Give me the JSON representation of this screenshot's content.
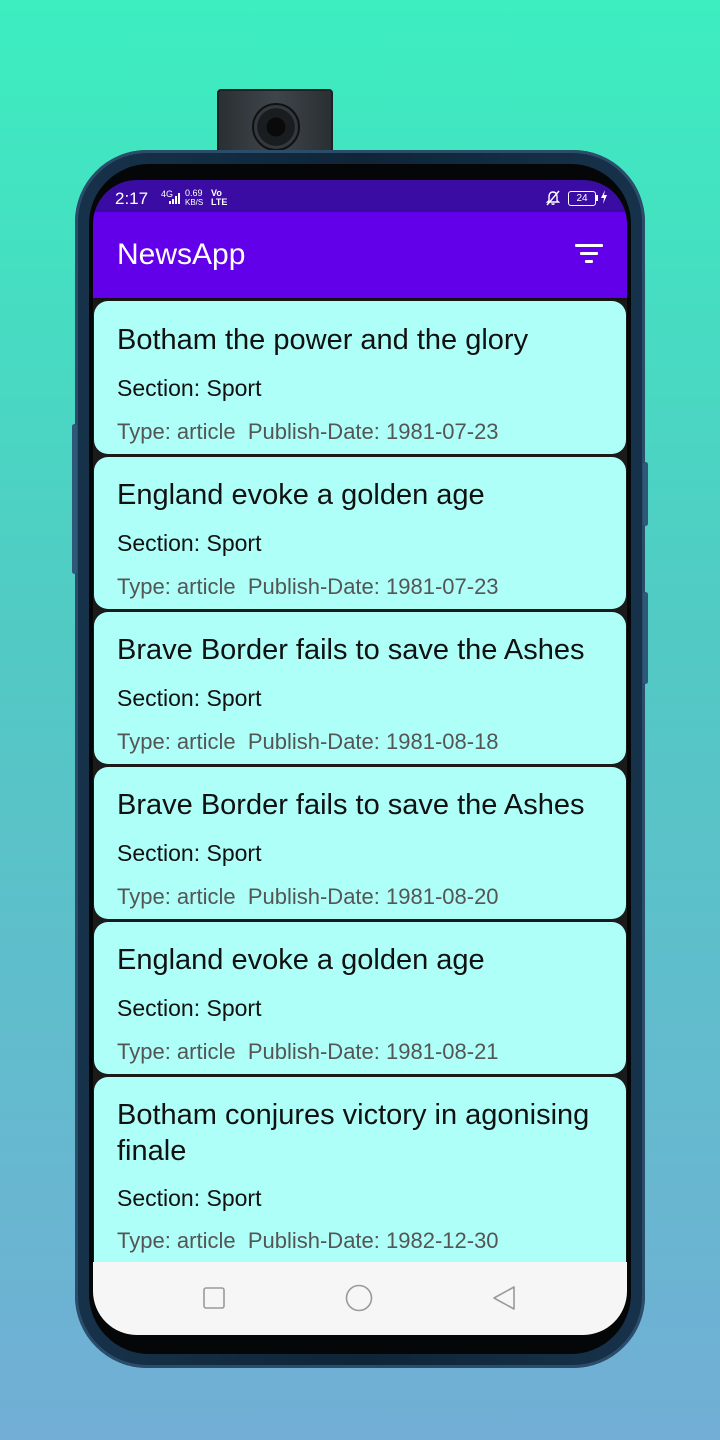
{
  "status_bar": {
    "time": "2:17",
    "network": "4G",
    "speed_value": "0.69",
    "speed_unit": "KB/S",
    "volte_top": "Vo",
    "volte_bottom": "LTE",
    "battery": "24"
  },
  "app_bar": {
    "title": "NewsApp",
    "filter_icon": "filter-list-icon"
  },
  "articles": [
    {
      "title": "Botham the power and the glory",
      "section": "Section: Sport",
      "meta": "Type: article  Publish-Date: 1981-07-23"
    },
    {
      "title": "England evoke a golden age",
      "section": "Section: Sport",
      "meta": "Type: article  Publish-Date: 1981-07-23"
    },
    {
      "title": "Brave Border fails to save the Ashes",
      "section": "Section: Sport",
      "meta": "Type: article  Publish-Date: 1981-08-18"
    },
    {
      "title": "Brave Border fails to save the Ashes",
      "section": "Section: Sport",
      "meta": "Type: article  Publish-Date: 1981-08-20"
    },
    {
      "title": "England evoke a golden age",
      "section": "Section: Sport",
      "meta": "Type: article  Publish-Date: 1981-08-21"
    },
    {
      "title": "Botham conjures victory in agonising finale",
      "section": "Section: Sport",
      "meta": "Type: article  Publish-Date: 1982-12-30"
    }
  ],
  "nav_bar": {
    "recents_icon": "square-icon",
    "home_icon": "circle-icon",
    "back_icon": "triangle-back-icon"
  },
  "colors": {
    "app_bar": "#6200ea",
    "status_bar": "#3a0ca3",
    "card_background": "#adfff8"
  }
}
